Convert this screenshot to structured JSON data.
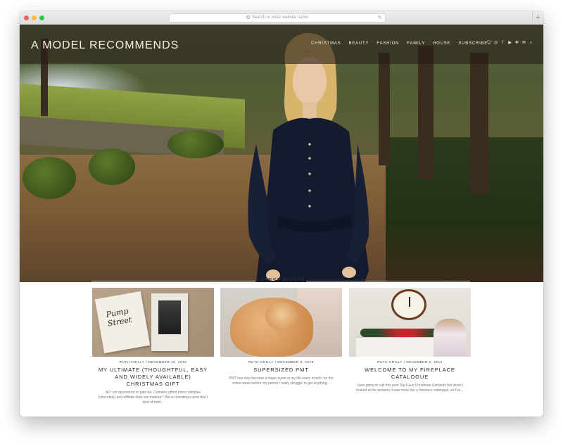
{
  "browser": {
    "url_placeholder": "Search or enter website name",
    "reload_glyph": "↻",
    "new_tab_glyph": "+"
  },
  "site": {
    "logo": "A MODEL RECOMMENDS",
    "nav": [
      "CHRISTMAS",
      "BEAUTY",
      "FASHION",
      "FAMILY",
      "HOUSE",
      "SUBSCRIBE"
    ],
    "social_icons": [
      {
        "name": "twitter-icon",
        "glyph": "🐦︎"
      },
      {
        "name": "instagram-icon",
        "glyph": "◎"
      },
      {
        "name": "facebook-icon",
        "glyph": "f"
      },
      {
        "name": "youtube-icon",
        "glyph": "▶"
      },
      {
        "name": "bloglovin-icon",
        "glyph": "✚"
      },
      {
        "name": "email-icon",
        "glyph": "✉"
      },
      {
        "name": "search-icon",
        "glyph": "⌕"
      }
    ]
  },
  "latest": {
    "heading": "LATEST POSTS",
    "posts": [
      {
        "meta": "RUTH CRILLY / DECEMBER 10, 2019",
        "title": "MY ULTIMATE (THOUGHTFUL, EASY AND WIDELY AVAILABLE) CHRISTMAS GIFT",
        "excerpt": "AD: not sponsored or paid-for. Contains gifted press samples (chocolate) and affiliate links are marked.* We're revisiting a post that I kind of held...",
        "thumb_text": "Pump Street"
      },
      {
        "meta": "RUTH CRILLY / DECEMBER 8, 2019",
        "title": "SUPERSIZED PMT",
        "excerpt": "PMT has now become a major event in my life every month; for the entire week before my period I really struggle to get anything..."
      },
      {
        "meta": "RUTH CRILLY / DECEMBER 6, 2019",
        "title": "WELCOME TO MY FIREPLACE CATALOGUE",
        "excerpt": "I was going to call this post Top Faux Christmas Garlands but when I looked at the pictures it was more like a fireplace catalogue, so I've..."
      }
    ]
  }
}
